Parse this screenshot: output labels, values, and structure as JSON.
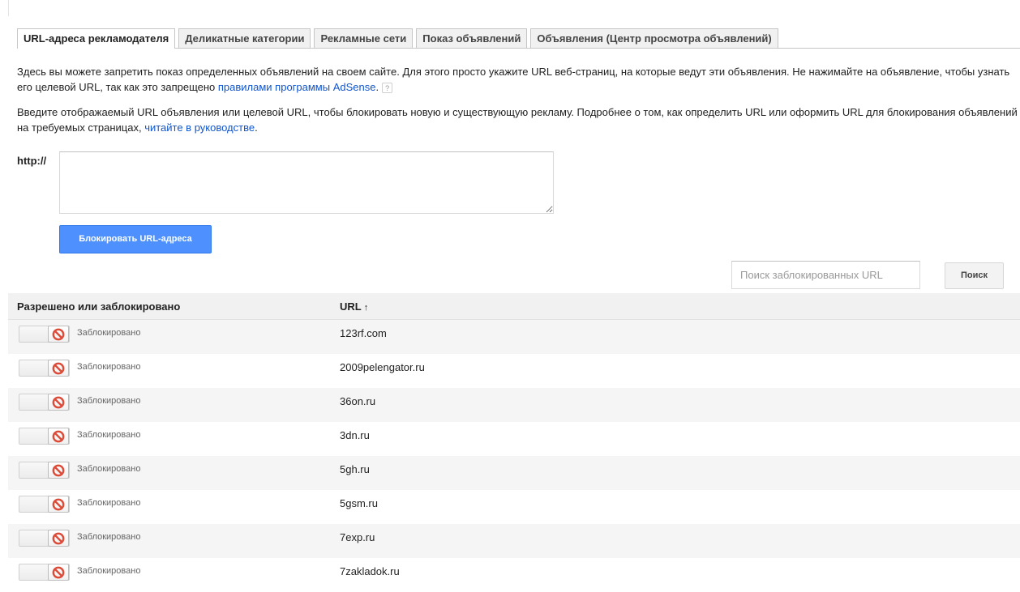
{
  "tabs": [
    {
      "label": "URL-адреса рекламодателя",
      "active": true
    },
    {
      "label": "Деликатные категории",
      "active": false
    },
    {
      "label": "Рекламные сети",
      "active": false
    },
    {
      "label": "Показ объявлений",
      "active": false
    },
    {
      "label": "Объявления (Центр просмотра объявлений)",
      "active": false
    }
  ],
  "intro": {
    "p1_text": "Здесь вы можете запретить показ определенных объявлений на своем сайте. Для этого просто укажите URL веб-страниц, на которые ведут эти объявления. Не нажимайте на объявление, чтобы узнать его целевой URL, так как это запрещено ",
    "p1_link": "правилами программы AdSense",
    "p1_end": ".",
    "help_icon": "?",
    "p2_text": "Введите отображаемый URL объявления или целевой URL, чтобы блокировать новую и существующую рекламу. Подробнее о том, как определить URL или оформить URL для блокирования объявлений на требуемых страницах, ",
    "p2_link": "читайте в руководстве",
    "p2_end": "."
  },
  "block_form": {
    "prefix_label": "http://",
    "textarea_value": "",
    "submit_label": "Блокировать URL-адреса"
  },
  "search": {
    "placeholder": "Поиск заблокированных URL",
    "value": "",
    "button_label": "Поиск"
  },
  "table": {
    "col_status": "Разрешено или заблокировано",
    "col_url": "URL",
    "sort_indicator": "↑",
    "rows": [
      {
        "status": "Заблокировано",
        "url": "123rf.com"
      },
      {
        "status": "Заблокировано",
        "url": "2009pelengator.ru"
      },
      {
        "status": "Заблокировано",
        "url": "36on.ru"
      },
      {
        "status": "Заблокировано",
        "url": "3dn.ru"
      },
      {
        "status": "Заблокировано",
        "url": "5gh.ru"
      },
      {
        "status": "Заблокировано",
        "url": "5gsm.ru"
      },
      {
        "status": "Заблокировано",
        "url": "7exp.ru"
      },
      {
        "status": "Заблокировано",
        "url": "7zakladok.ru"
      }
    ]
  },
  "colors": {
    "accent": "#4d90fe",
    "link": "#1155cc",
    "blocked_icon": "#dd4b39"
  },
  "icons": {
    "blocked": "block-icon",
    "sort": "sort-ascending-icon",
    "help": "help-icon"
  }
}
